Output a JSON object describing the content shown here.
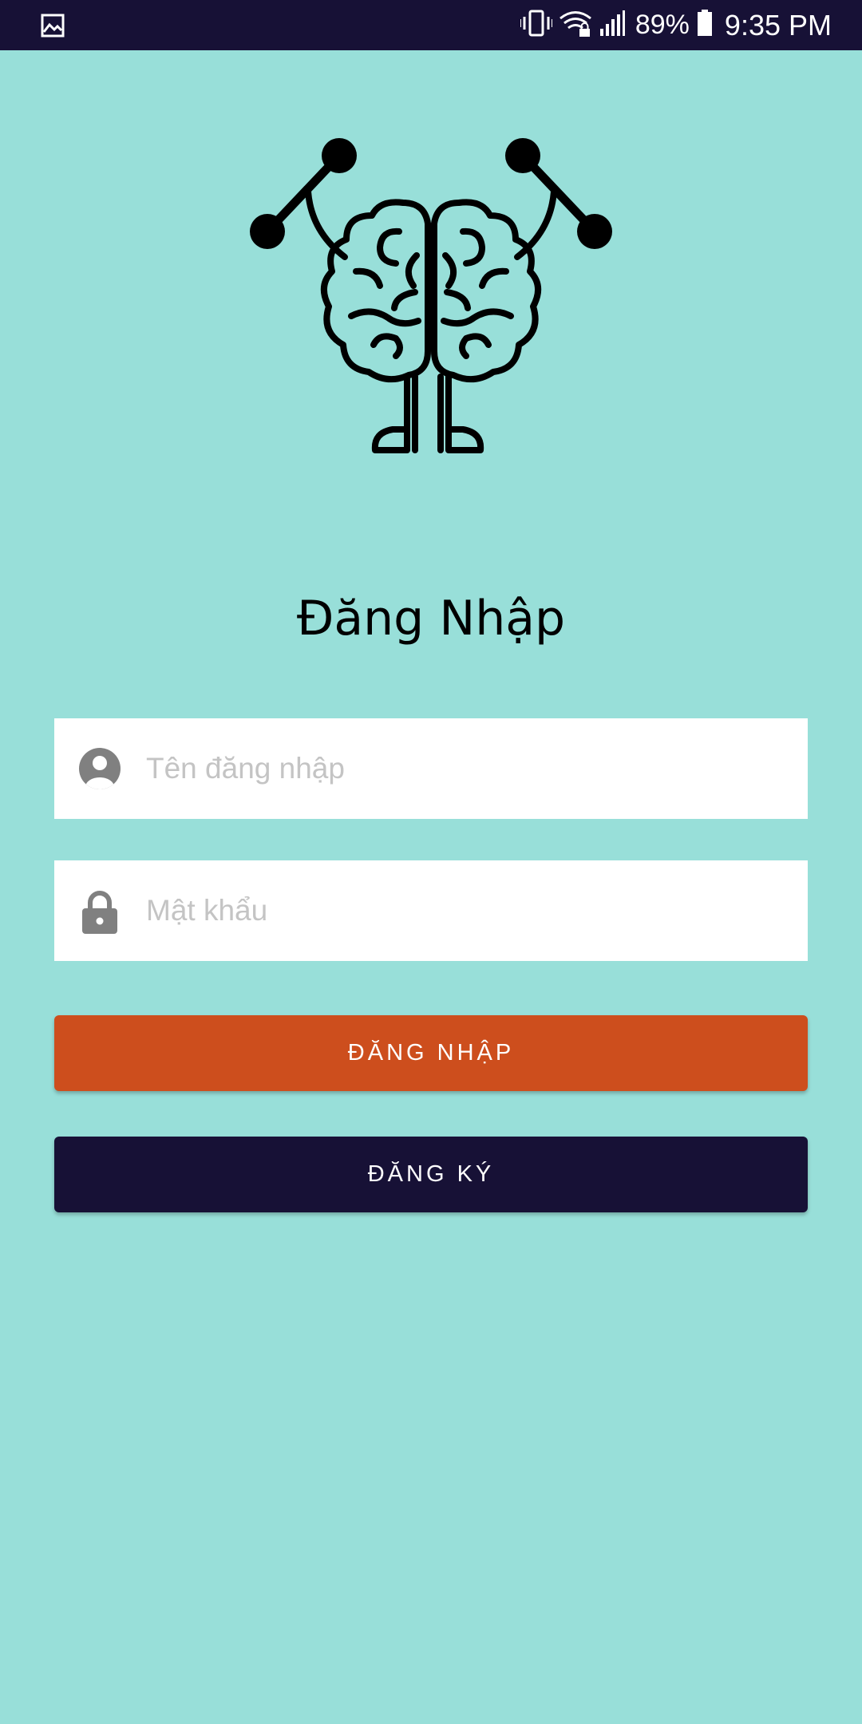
{
  "status_bar": {
    "battery_percent": "89%",
    "time": "9:35 PM",
    "icons": [
      "image-icon",
      "vibrate-icon",
      "wifi-lock-icon",
      "signal-icon",
      "battery-icon"
    ]
  },
  "logo": {
    "icon": "brain-lifting-icon"
  },
  "page": {
    "title": "Đăng Nhập"
  },
  "form": {
    "username": {
      "placeholder": "Tên đăng nhập",
      "value": "",
      "icon": "account-circle-icon"
    },
    "password": {
      "placeholder": "Mật khẩu",
      "value": "",
      "icon": "lock-icon"
    }
  },
  "buttons": {
    "login_label": "ĐĂNG NHẬP",
    "register_label": "ĐĂNG KÝ"
  },
  "colors": {
    "background": "#98dfd9",
    "status_bar": "#171136",
    "login_button": "#cd4e1d",
    "register_button": "#171136",
    "field_icon": "#808080",
    "placeholder": "#c4c4c4"
  }
}
